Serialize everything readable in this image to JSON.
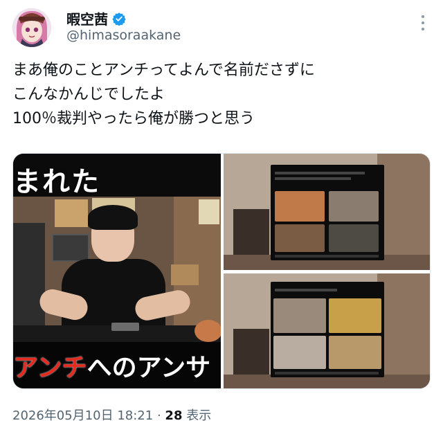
{
  "author": {
    "display_name": "暇空茜",
    "handle": "@himasoraakane",
    "avatar_icon": "anime-avatar-icon",
    "verified_icon": "verified-badge-icon"
  },
  "post": {
    "lines": [
      "まあ俺のことアンチってよんで名前ださずに",
      "こんなかんじでしたよ",
      "100％裁判やったら俺が勝つと思う"
    ]
  },
  "media": {
    "left_caption_top": "まれた",
    "left_caption_bottom_red": "アンチ",
    "left_caption_bottom_white": "へのアンサ"
  },
  "footer": {
    "timestamp": "2026年05月10日 18:21",
    "separator": "·",
    "views_count": "28",
    "views_label": "表示"
  },
  "colors": {
    "verified": "#1d9bf0",
    "secondary_text": "#536471",
    "primary_text": "#0f1419",
    "caption_red": "#e52a20"
  },
  "menu_icon": "more-options-icon"
}
